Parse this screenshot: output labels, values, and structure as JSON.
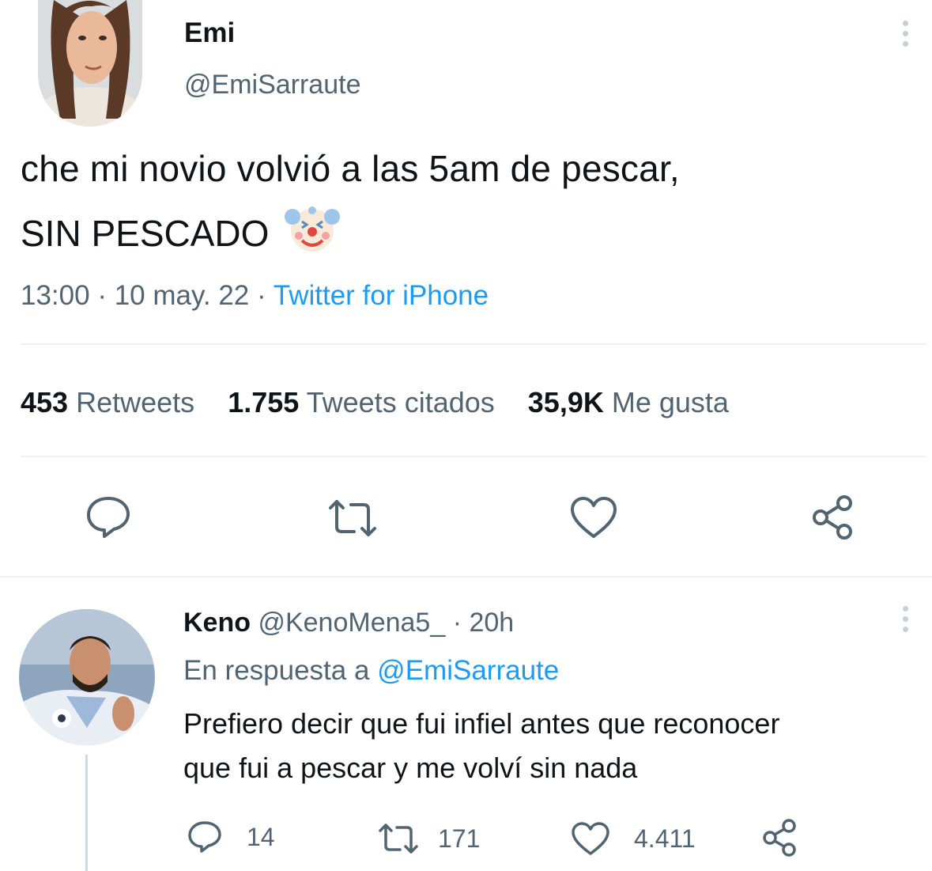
{
  "tweet": {
    "author_name": "Emi",
    "handle": "@EmiSarraute",
    "text_line1": "che mi novio volvió a las 5am de pescar,",
    "text_line2": "SIN PESCADO",
    "emoji_icon": "clown-face-icon",
    "time": "13:00",
    "date": "10 may. 22",
    "source": "Twitter for iPhone",
    "separator": "·",
    "stats": {
      "retweets_count": "453",
      "retweets_label": "Retweets",
      "quotes_count": "1.755",
      "quotes_label": "Tweets citados",
      "likes_count": "35,9K",
      "likes_label": "Me gusta"
    },
    "actions": [
      "reply-icon",
      "retweet-icon",
      "like-icon",
      "share-icon"
    ]
  },
  "reply": {
    "author_name": "Keno",
    "handle": "@KenoMena5_",
    "separator": "·",
    "age": "20h",
    "replying_prefix": "En respuesta a",
    "replying_to": "@EmiSarraute",
    "text_line1": "Prefiero decir que fui infiel antes que reconocer",
    "text_line2": "que fui a pescar y me volví sin nada",
    "counts": {
      "replies": "14",
      "retweets": "171",
      "likes": "4.411"
    }
  },
  "colors": {
    "link": "#1d9bf0",
    "muted": "#536471",
    "icon": "#536471",
    "divider": "#eff3f4"
  }
}
